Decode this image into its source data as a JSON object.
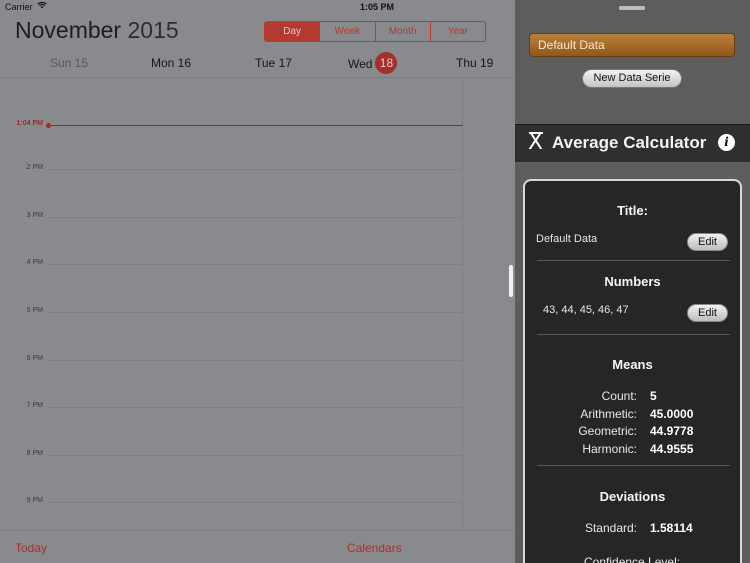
{
  "status_bar": {
    "carrier": "Carrier",
    "wifi_icon": "wifi-icon",
    "time": "1:05 PM"
  },
  "calendar": {
    "month": "November",
    "year": "2015",
    "segments": [
      "Day",
      "Week",
      "Month",
      "Year"
    ],
    "selected_segment": "Day",
    "days": [
      {
        "name": "Sun 15"
      },
      {
        "name": "Mon 16"
      },
      {
        "name": "Tue 17"
      },
      {
        "name": "Wed",
        "badge": "18"
      },
      {
        "name": "Thu 19"
      }
    ],
    "now_label": "1:04 PM",
    "hours": [
      "2 PM",
      "3 PM",
      "4 PM",
      "5 PM",
      "6 PM",
      "7 PM",
      "8 PM",
      "9 PM"
    ],
    "today_label": "Today",
    "calendars_label": "Calendars"
  },
  "panel": {
    "dataset_name": "Default Data",
    "new_serie_label": "New Data Serie",
    "app_icon": "x-bar-icon",
    "app_title": "Average Calculator",
    "info_icon": "i",
    "title_section": {
      "heading": "Title:",
      "value": "Default Data",
      "edit_label": "Edit"
    },
    "numbers_section": {
      "heading": "Numbers",
      "value": "43, 44, 45, 46, 47",
      "edit_label": "Edit"
    },
    "means_section": {
      "heading": "Means",
      "rows": [
        {
          "key": "Count:",
          "value": "5"
        },
        {
          "key": "Arithmetic:",
          "value": "45.0000"
        },
        {
          "key": "Geometric:",
          "value": "44.9778"
        },
        {
          "key": "Harmonic:",
          "value": "44.9555"
        }
      ]
    },
    "deviations_section": {
      "heading": "Deviations",
      "rows": [
        {
          "key": "Standard:",
          "value": "1.58114"
        }
      ],
      "partial_label": "Confidence Level:"
    }
  },
  "colors": {
    "accent_red": "#b23a31",
    "dataset_orange": "#a86c2c",
    "panel_dark": "#262626"
  }
}
